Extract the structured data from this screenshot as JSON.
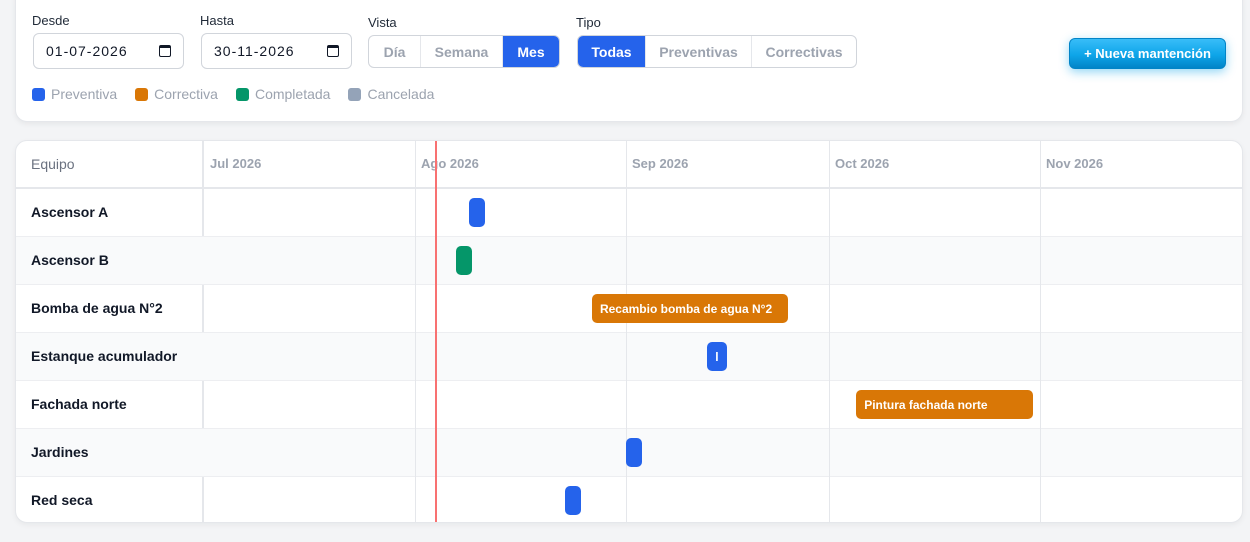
{
  "filters": {
    "desde_label": "Desde",
    "desde_value": "01-07-2026",
    "hasta_label": "Hasta",
    "hasta_value": "30-11-2026",
    "vista_label": "Vista",
    "vista_options": [
      "Día",
      "Semana",
      "Mes"
    ],
    "vista_selected": "Mes",
    "tipo_label": "Tipo",
    "tipo_options": [
      "Todas",
      "Preventivas",
      "Correctivas"
    ],
    "tipo_selected": "Todas"
  },
  "new_button_label": "+ Nueva mantención",
  "legend": [
    {
      "label": "Preventiva",
      "color": "#2563eb"
    },
    {
      "label": "Correctiva",
      "color": "#d97706"
    },
    {
      "label": "Completada",
      "color": "#059669"
    },
    {
      "label": "Cancelada",
      "color": "#94a3b8"
    }
  ],
  "gantt": {
    "equipo_header": "Equipo",
    "months": [
      "Jul 2026",
      "Ago 2026",
      "Sep 2026",
      "Oct 2026",
      "Nov 2026"
    ],
    "rows": [
      {
        "name": "Ascensor A"
      },
      {
        "name": "Ascensor B"
      },
      {
        "name": "Bomba de agua N°2"
      },
      {
        "name": "Estanque acumulador"
      },
      {
        "name": "Fachada norte"
      },
      {
        "name": "Jardines"
      },
      {
        "name": "Red seca"
      }
    ],
    "tasks": [
      {
        "row": 0,
        "start": "2026-08-09",
        "end": "2026-08-11",
        "status": "Preventiva",
        "label": ""
      },
      {
        "row": 1,
        "start": "2026-08-07",
        "end": "2026-08-09",
        "status": "Completada",
        "label": ""
      },
      {
        "row": 2,
        "start": "2026-08-27",
        "end": "2026-09-25",
        "status": "Correctiva",
        "label": "Recambio bomba de agua N°2"
      },
      {
        "row": 3,
        "start": "2026-09-13",
        "end": "2026-09-16",
        "status": "Preventiva",
        "label": "l"
      },
      {
        "row": 4,
        "start": "2026-10-05",
        "end": "2026-10-31",
        "status": "Correctiva",
        "label": "Pintura fachada norte"
      },
      {
        "row": 5,
        "start": "2026-09-01",
        "end": "2026-09-03",
        "status": "Preventiva",
        "label": ""
      },
      {
        "row": 6,
        "start": "2026-08-23",
        "end": "2026-08-25",
        "status": "Preventiva",
        "label": ""
      }
    ],
    "today": "2026-08-01",
    "today_color": "#f87171"
  }
}
